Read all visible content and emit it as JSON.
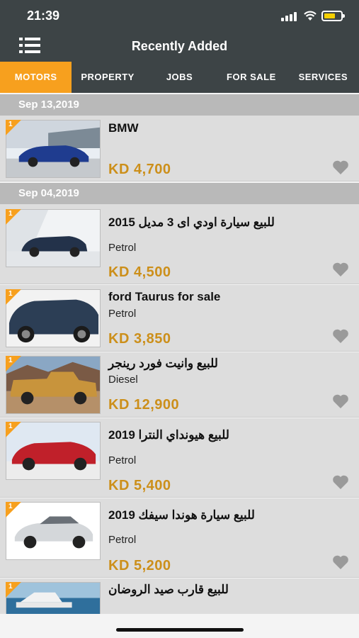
{
  "status_bar": {
    "time": "21:39"
  },
  "header": {
    "title": "Recently Added"
  },
  "tabs": [
    {
      "label": "MOTORS",
      "active": true
    },
    {
      "label": "PROPERTY",
      "active": false
    },
    {
      "label": "JOBS",
      "active": false
    },
    {
      "label": "FOR SALE",
      "active": false
    },
    {
      "label": "SERVICES",
      "active": false
    }
  ],
  "sections": [
    {
      "date": "Sep 13,2019",
      "items": [
        {
          "badge": "1",
          "title": "BMW",
          "fuel": "",
          "price": "KD 4,700",
          "icon": "heart-icon"
        }
      ]
    },
    {
      "date": "Sep 04,2019",
      "items": [
        {
          "badge": "1",
          "title": "للبيع سيارة اودي اى 3 مديل 2015",
          "fuel": "Petrol",
          "price": "KD 4,500",
          "icon": "heart-icon"
        },
        {
          "badge": "1",
          "title": "ford Taurus for sale",
          "fuel": "Petrol",
          "price": "KD 3,850",
          "icon": "heart-icon"
        },
        {
          "badge": "1",
          "title": "للبيع وانيت فورد رينجر",
          "fuel": "Diesel",
          "price": "KD 12,900",
          "icon": "heart-icon"
        },
        {
          "badge": "1",
          "title": "للبيع هيونداي النترا 2019",
          "fuel": "Petrol",
          "price": "KD 5,400",
          "icon": "heart-icon"
        },
        {
          "badge": "1",
          "title": "للبيع سيارة هوندا سيفك 2019",
          "fuel": "Petrol",
          "price": "KD 5,200",
          "icon": "heart-icon"
        },
        {
          "badge": "1",
          "title": "للبيع قارب صيد الروضان",
          "fuel": "",
          "price": "",
          "icon": "heart-icon"
        }
      ]
    }
  ],
  "colors": {
    "accent": "#f7a01e",
    "price": "#cc8f1a",
    "header_bg": "#3d4446"
  }
}
